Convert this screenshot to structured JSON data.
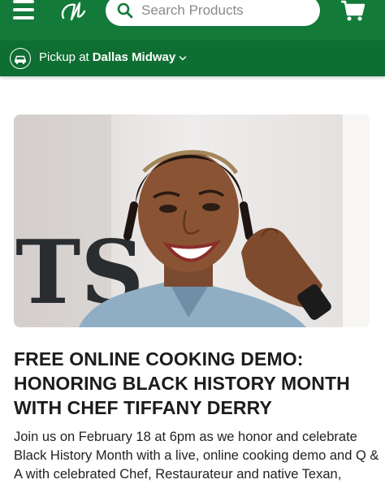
{
  "colors": {
    "header_bg": "#137a3a",
    "pickup_bg": "#0f6e32",
    "text": "#1c1c1c"
  },
  "header": {
    "menu_icon": "hamburger-menu-icon",
    "logo_icon": "central-market-logo-icon",
    "search_placeholder": "Search Products",
    "search_icon": "search-icon",
    "cart_icon": "shopping-cart-icon"
  },
  "pickup": {
    "icon": "car-pickup-icon",
    "label": "Pickup at",
    "store": "Dallas Midway"
  },
  "article": {
    "image_alt": "Chef Tiffany Derry smiling",
    "image_letters": "TS",
    "title_line1": "FREE ONLINE COOKING DEMO:",
    "title_line2": "HONORING BLACK HISTORY MONTH",
    "title_line3": "WITH CHEF TIFFANY DERRY",
    "body": "Join us on February 18 at 6pm as we honor and celebrate Black History Month with a live, online cooking demo and Q & A with celebrated Chef, Restaurateur and native Texan,"
  }
}
